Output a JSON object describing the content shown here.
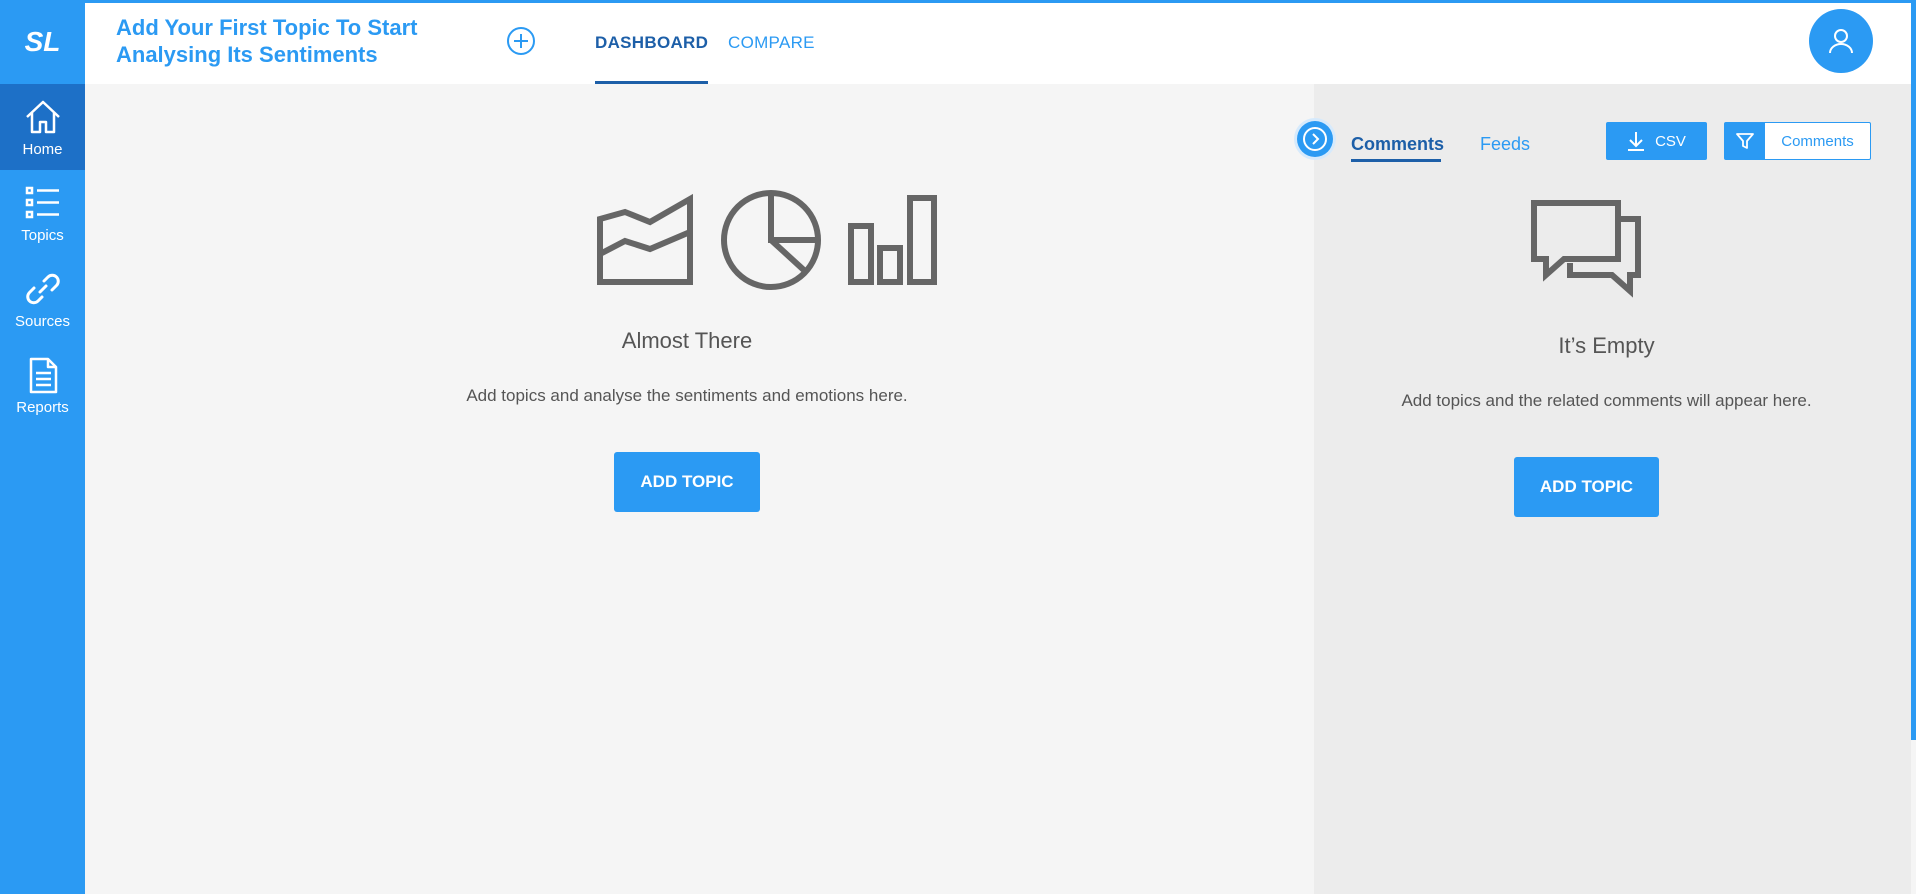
{
  "sidebar": {
    "logo": "SL",
    "items": [
      {
        "label": "Home",
        "icon": "home-icon"
      },
      {
        "label": "Topics",
        "icon": "list-icon"
      },
      {
        "label": "Sources",
        "icon": "link-icon"
      },
      {
        "label": "Reports",
        "icon": "document-icon"
      }
    ]
  },
  "header": {
    "title": "Add Your First Topic To Start Analysing Its Sentiments",
    "tabs": [
      "DASHBOARD",
      "COMPARE"
    ]
  },
  "main": {
    "heading": "Almost There",
    "description": "Add topics and analyse the sentiments and emotions here.",
    "button": "ADD TOPIC",
    "icons": [
      "area-chart-icon",
      "pie-chart-icon",
      "bar-chart-icon"
    ]
  },
  "panel": {
    "tabs": [
      "Comments",
      "Feeds"
    ],
    "csv_button": "CSV",
    "filter_label": "Comments",
    "heading": "It’s Empty",
    "description": "Add topics and the related comments will appear here.",
    "button": "ADD TOPIC",
    "icon": "comments-icon"
  },
  "colors": {
    "primary": "#2b9af3",
    "primary_dark": "#1d5fa8",
    "sidebar_active": "#1d70c7",
    "text_gray": "#555555",
    "icon_gray": "#666666"
  }
}
